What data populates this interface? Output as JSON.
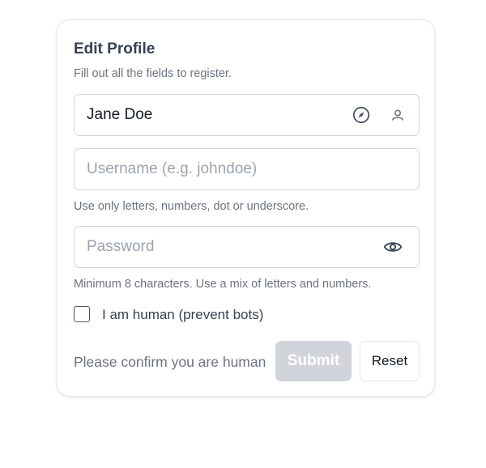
{
  "form": {
    "title": "Edit Profile",
    "subtitle": "Fill out all the fields to register.",
    "name_field": {
      "value": "Jane Doe",
      "placeholder": "",
      "icons": [
        "compass-icon",
        "user-icon"
      ]
    },
    "username_field": {
      "value": "",
      "placeholder": "Username (e.g. johndoe)",
      "hint": "Use only letters, numbers, dot or underscore."
    },
    "password_field": {
      "value": "",
      "placeholder": "Password",
      "hint": "Minimum 8 characters. Use a mix of letters and numbers.",
      "icons": [
        "eye-icon"
      ]
    },
    "human_check": {
      "label": "I am human (prevent bots)",
      "checked": false
    },
    "confirm_text": "Please confirm you are human",
    "submit_label": "Submit",
    "reset_label": "Reset"
  },
  "colors": {
    "border": "#d1d5db",
    "muted_text": "#6b7280",
    "disabled_button": "#d1d5db",
    "title_text": "#374151"
  }
}
